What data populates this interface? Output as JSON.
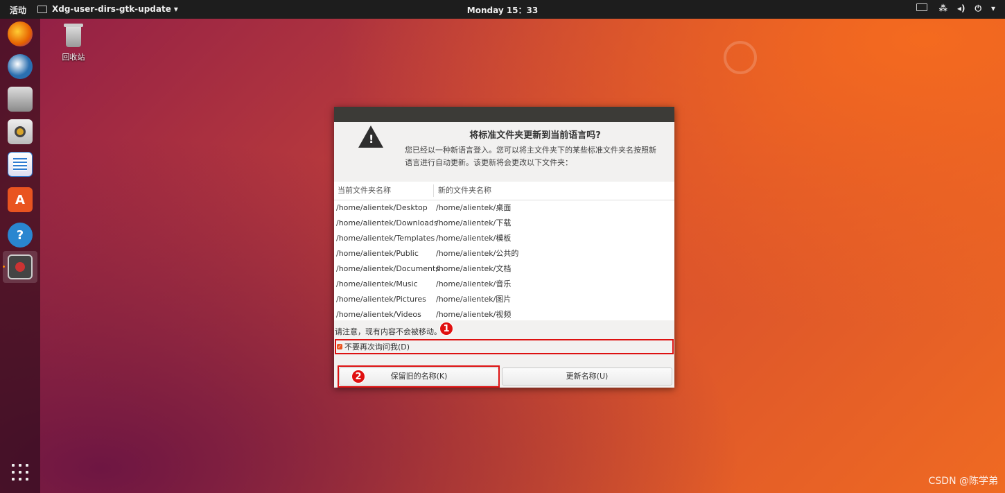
{
  "topbar": {
    "activities": "活动",
    "app_menu": "Xdg-user-dirs-gtk-update",
    "app_menu_arrow": "▾",
    "clock": "Monday 15：33",
    "tray": {
      "network": "⁂",
      "volume": "◂)",
      "power": "⏻",
      "arrow": "▾"
    }
  },
  "dock": {
    "items": [
      {
        "name": "firefox",
        "color": "#e66000"
      },
      {
        "name": "thunderbird",
        "color": "#2a6fb0"
      },
      {
        "name": "files",
        "color": "#9a9a9a"
      },
      {
        "name": "rhythmbox",
        "color": "#d9c27a"
      },
      {
        "name": "libreoffice-writer",
        "color": "#2f7bd1"
      },
      {
        "name": "ubuntu-software",
        "color": "#e95420",
        "glyph": "A"
      },
      {
        "name": "help",
        "color": "#2a86d0",
        "glyph": "?"
      },
      {
        "name": "xdg-update",
        "color": "#555"
      }
    ]
  },
  "desktop": {
    "trash_label": "回收站"
  },
  "dialog": {
    "title": "将标准文件夹更新到当前语言吗?",
    "message": "您已经以一种新语言登入。您可以将主文件夹下的某些标准文件夹名按照新语言进行自动更新。该更新将会更改以下文件夹：",
    "warn_glyph": "!",
    "columns": [
      "当前文件夹名称",
      "新的文件夹名称"
    ],
    "rows": [
      [
        "/home/alientek/Desktop",
        "/home/alientek/桌面"
      ],
      [
        "/home/alientek/Downloads",
        "/home/alientek/下载"
      ],
      [
        "/home/alientek/Templates",
        "/home/alientek/模板"
      ],
      [
        "/home/alientek/Public",
        "/home/alientek/公共的"
      ],
      [
        "/home/alientek/Documents",
        "/home/alientek/文档"
      ],
      [
        "/home/alientek/Music",
        "/home/alientek/音乐"
      ],
      [
        "/home/alientek/Pictures",
        "/home/alientek/图片"
      ],
      [
        "/home/alientek/Videos",
        "/home/alientek/视频"
      ]
    ],
    "note": "请注意，现有内容不会被移动。",
    "checkbox_label": "不要再次询问我(D)",
    "checkbox_checked": true,
    "keep_button": "保留旧的名称(K)",
    "update_button": "更新名称(U)"
  },
  "annotations": {
    "badge1": "1",
    "badge2": "2"
  },
  "watermark": "CSDN @陈学弟"
}
